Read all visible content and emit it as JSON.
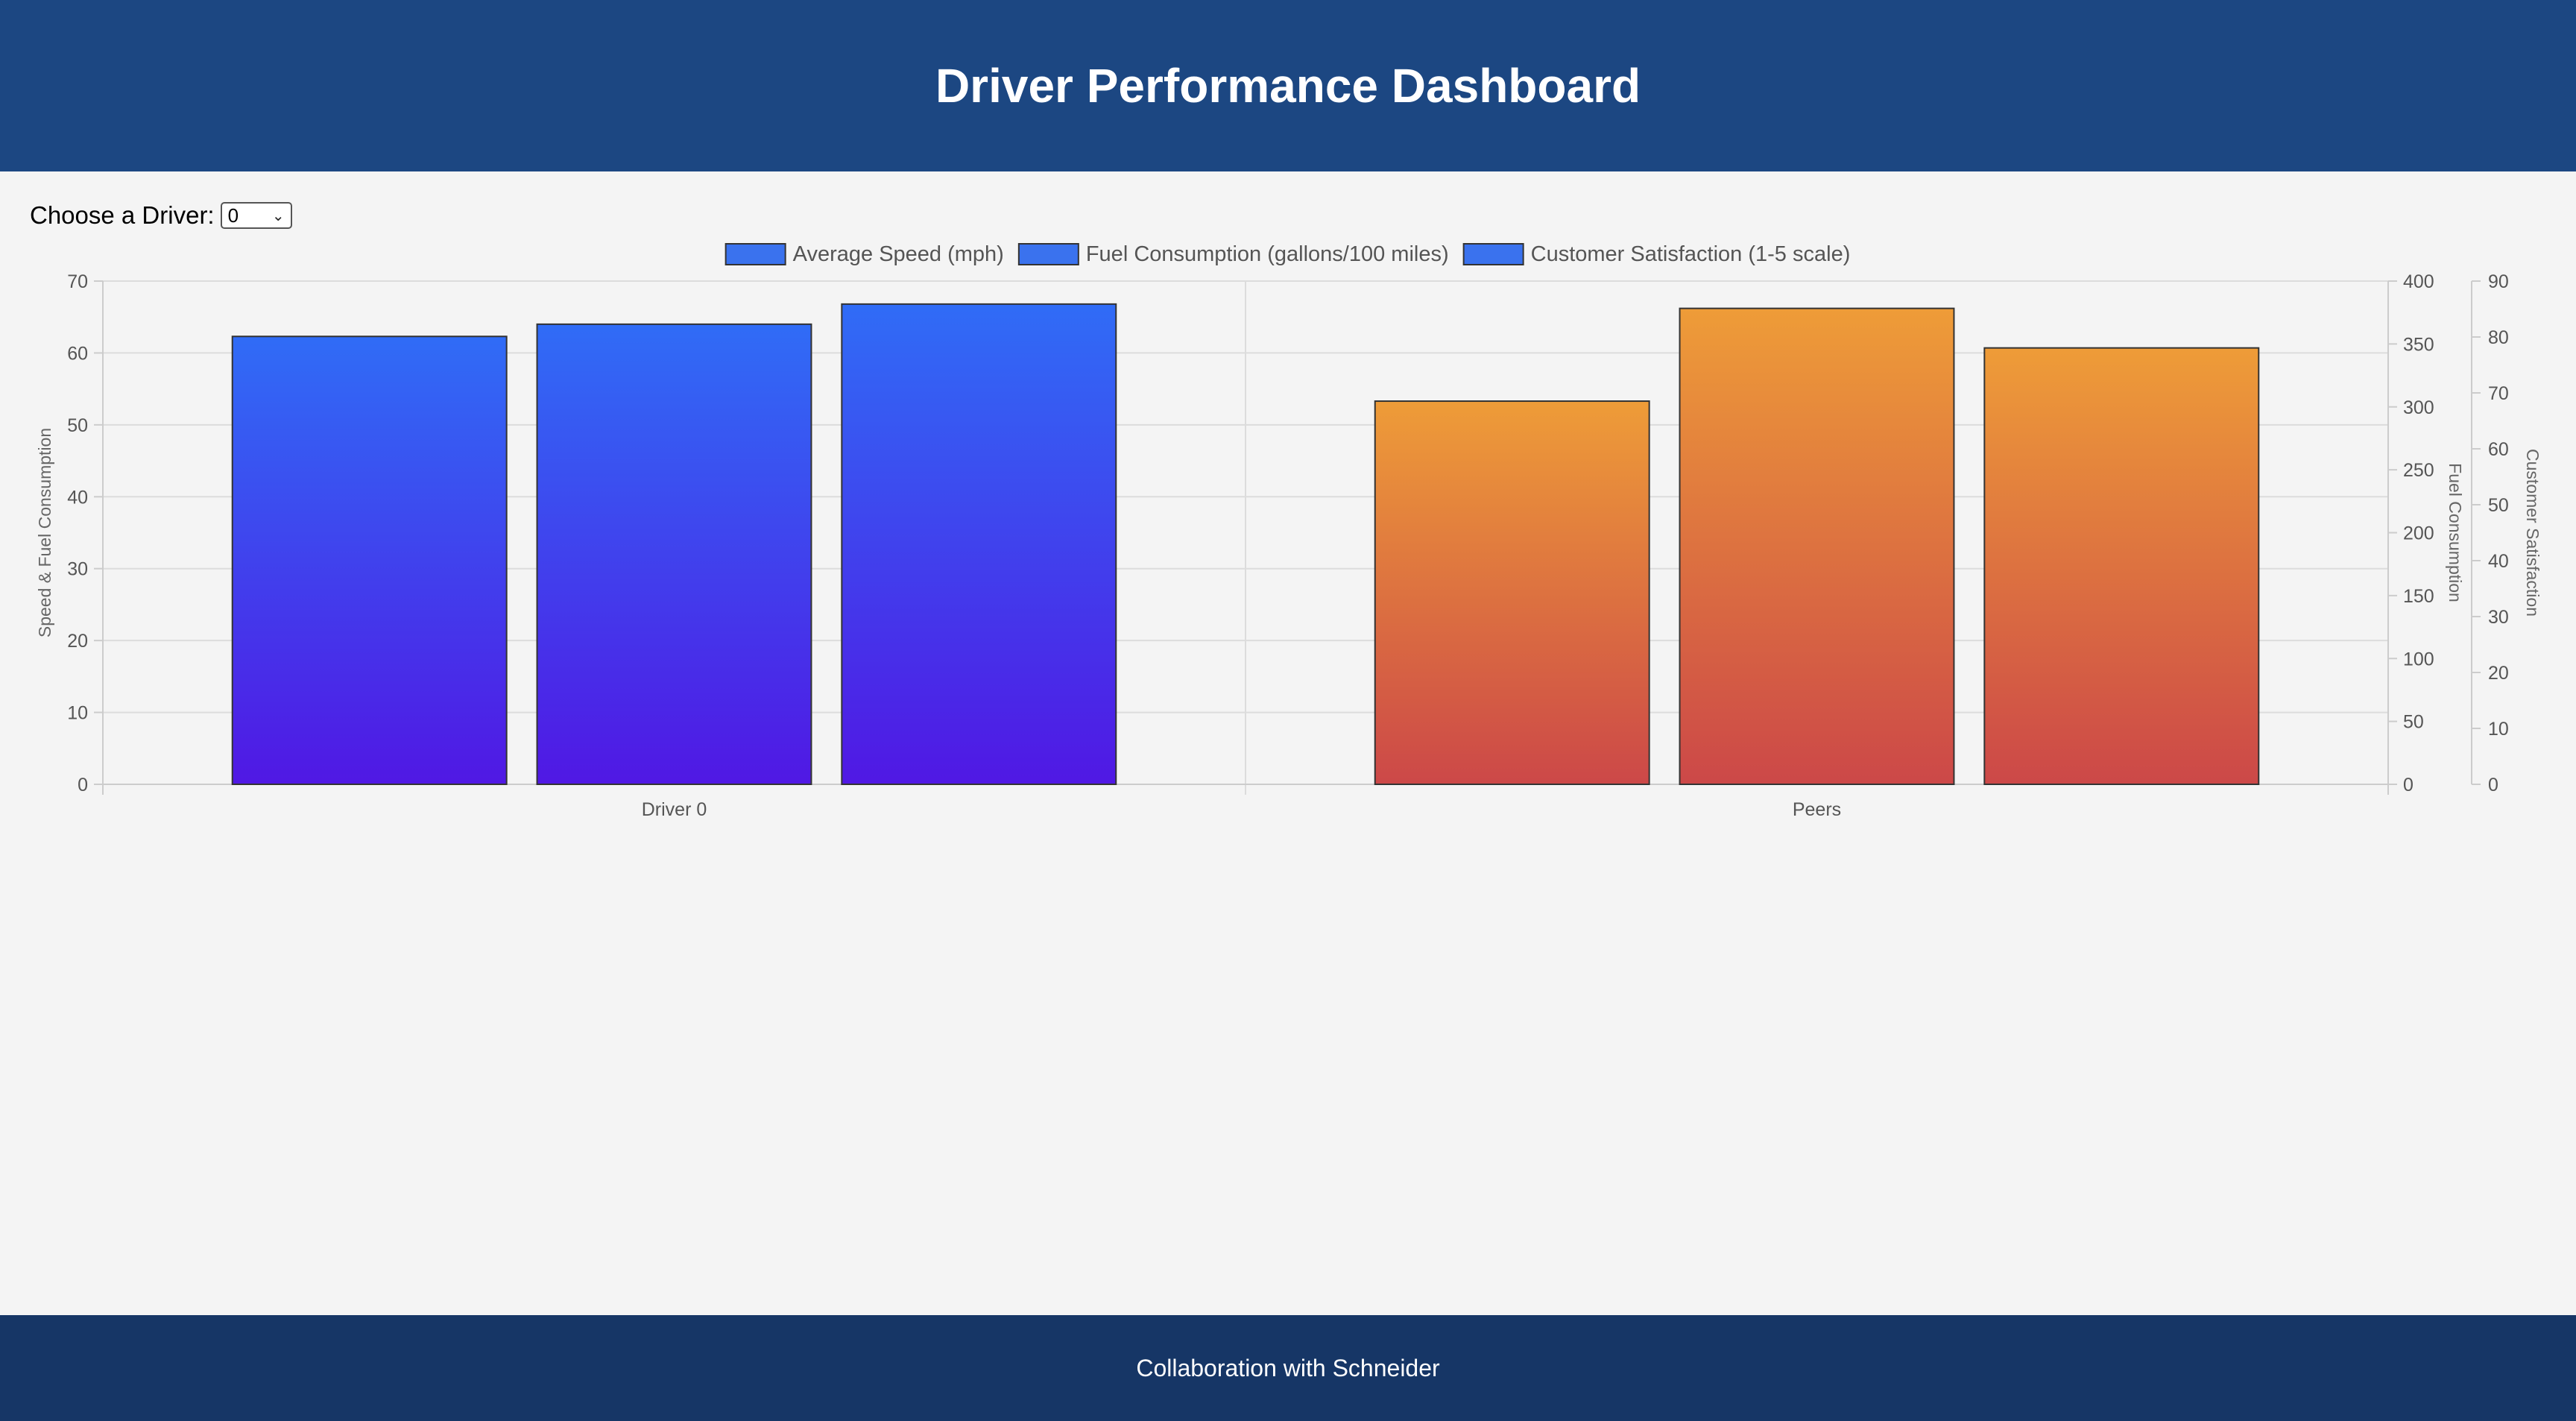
{
  "header": {
    "title": "Driver Performance Dashboard"
  },
  "controls": {
    "label": "Choose a Driver:",
    "selected_driver": "0"
  },
  "footer": {
    "text": "Collaboration with Schneider"
  },
  "colors": {
    "header_bg": "#1c4782",
    "footer_bg": "#163666",
    "driver_gradient": [
      "#306cf6",
      "#5018e4"
    ],
    "peer_gradient": [
      "#ee9c38",
      "#cc4848"
    ],
    "legend_swatch": "#3a72ee"
  },
  "chart_data": {
    "type": "bar",
    "categories": [
      "Driver 0",
      "Peers"
    ],
    "series": [
      {
        "name": "Average Speed (mph)",
        "values": [
          62.3,
          53.3
        ]
      },
      {
        "name": "Fuel Consumption (gallons/100 miles)",
        "values": [
          64.0,
          66.2
        ]
      },
      {
        "name": "Customer Satisfaction (1-5 scale)",
        "values": [
          66.8,
          60.7
        ]
      }
    ],
    "legend_position": "top",
    "grid": true,
    "axes": {
      "y_left": {
        "label": "Speed & Fuel Consumption",
        "ylim": [
          0,
          70
        ],
        "ticks": [
          "0",
          "10",
          "20",
          "30",
          "40",
          "50",
          "60",
          "70"
        ]
      },
      "y_right_1": {
        "label": "Fuel Consumption",
        "ylim": [
          0,
          400
        ],
        "ticks": [
          "0",
          "50",
          "100",
          "150",
          "200",
          "250",
          "300",
          "350",
          "400"
        ]
      },
      "y_right_2": {
        "label": "Customer Satisfaction",
        "ylim": [
          0,
          90
        ],
        "ticks": [
          "0",
          "10",
          "20",
          "30",
          "40",
          "50",
          "60",
          "70",
          "80",
          "90"
        ]
      }
    }
  }
}
